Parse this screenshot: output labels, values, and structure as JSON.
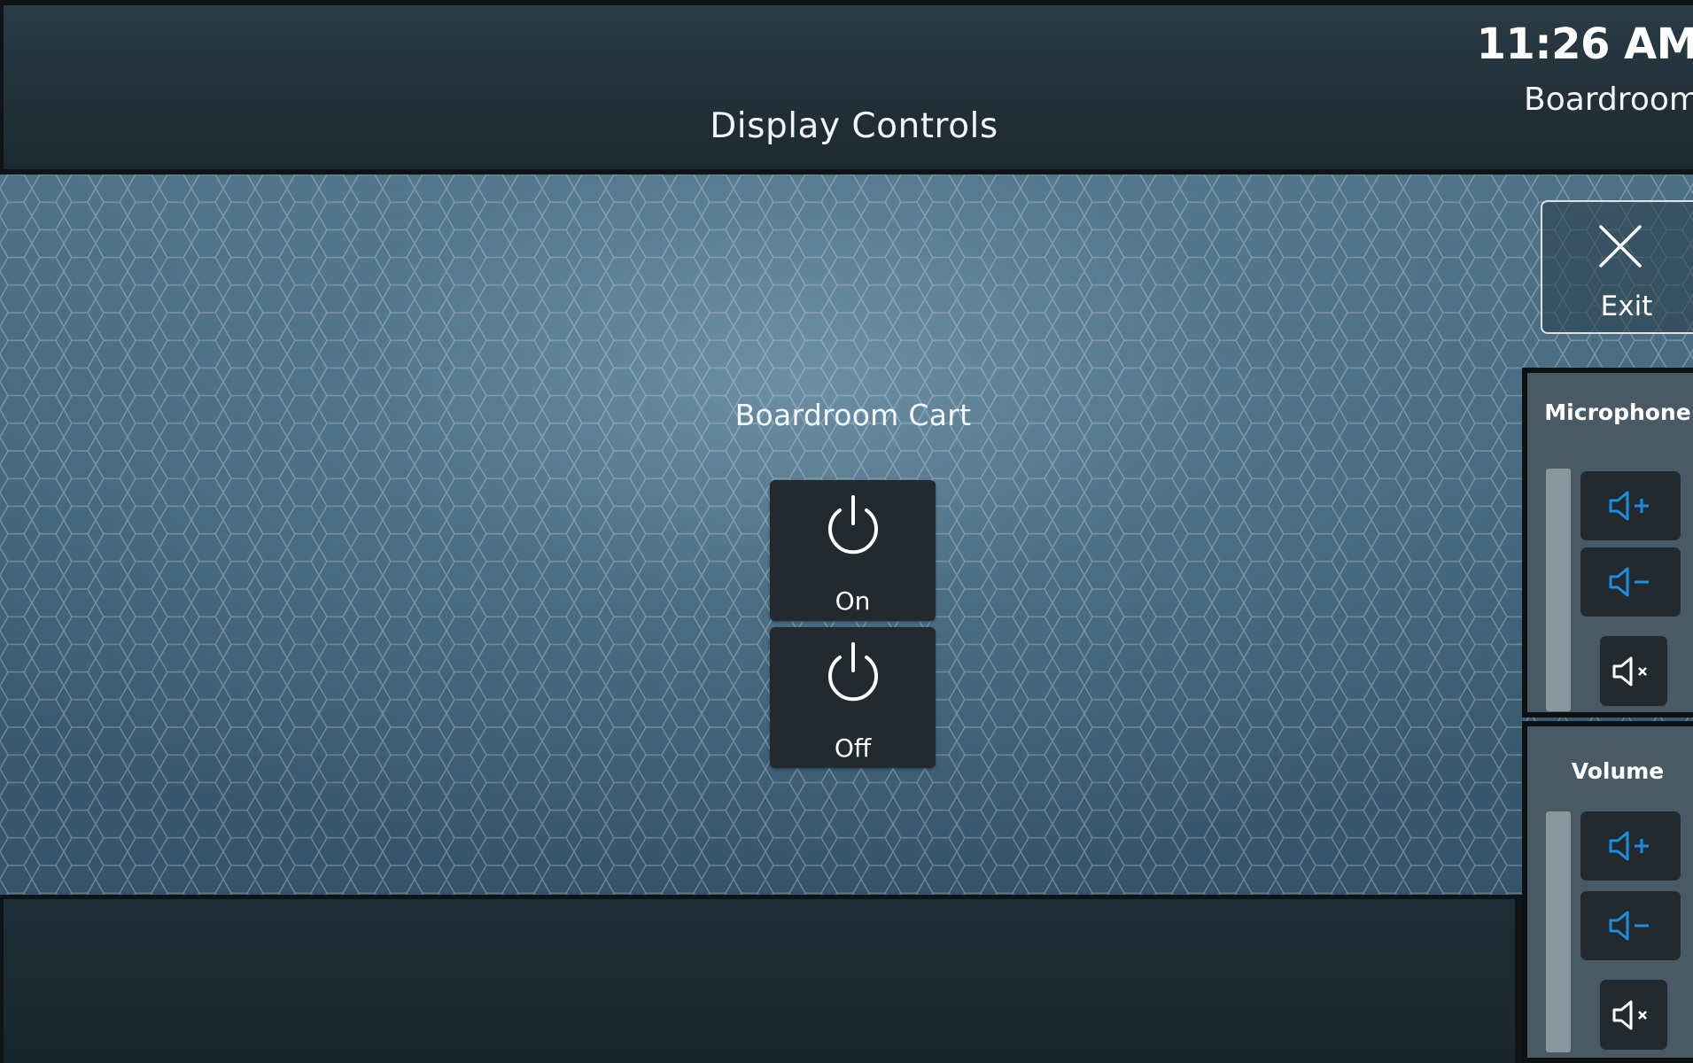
{
  "header": {
    "title": "Display Controls",
    "time": "11:26 AM",
    "room": "Boardroom"
  },
  "main": {
    "device_name": "Boardroom Cart",
    "power_on_label": "On",
    "power_off_label": "Off"
  },
  "sidebar": {
    "exit_label": "Exit",
    "microphone": {
      "title": "Microphone",
      "level_percent": 0
    },
    "volume": {
      "title": "Volume",
      "level_percent": 0
    }
  },
  "colors": {
    "accent": "#1e8fe0",
    "button_bg": "#22292f",
    "header_bg": "#233039"
  },
  "icons": {
    "power": "power-icon",
    "exit": "close-icon",
    "volume_up": "volume-up-icon",
    "volume_down": "volume-down-icon",
    "mute": "mute-icon"
  }
}
